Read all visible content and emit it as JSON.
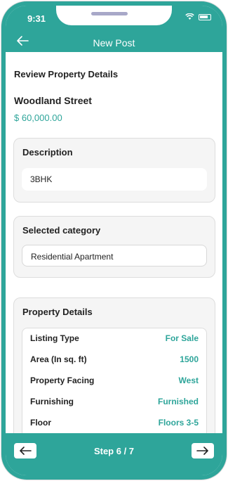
{
  "status_bar": {
    "time": "9:31"
  },
  "header": {
    "title": "New Post"
  },
  "review": {
    "section_title": "Review Property Details",
    "property_name": "Woodland Street",
    "price": "$ 60,000.00"
  },
  "description": {
    "label": "Description",
    "value": "3BHK"
  },
  "category": {
    "label": "Selected category",
    "value": "Residential Apartment"
  },
  "property_details": {
    "label": "Property Details",
    "rows": [
      {
        "label": "Listing Type",
        "value": "For Sale"
      },
      {
        "label": "Area (In sq. ft)",
        "value": "1500"
      },
      {
        "label": "Property Facing",
        "value": "West"
      },
      {
        "label": "Furnishing",
        "value": "Furnished"
      },
      {
        "label": "Floor",
        "value": "Floors 3-5"
      }
    ]
  },
  "footer": {
    "step_label": "Step 6 / 7"
  },
  "colors": {
    "accent": "#2ea59a"
  }
}
